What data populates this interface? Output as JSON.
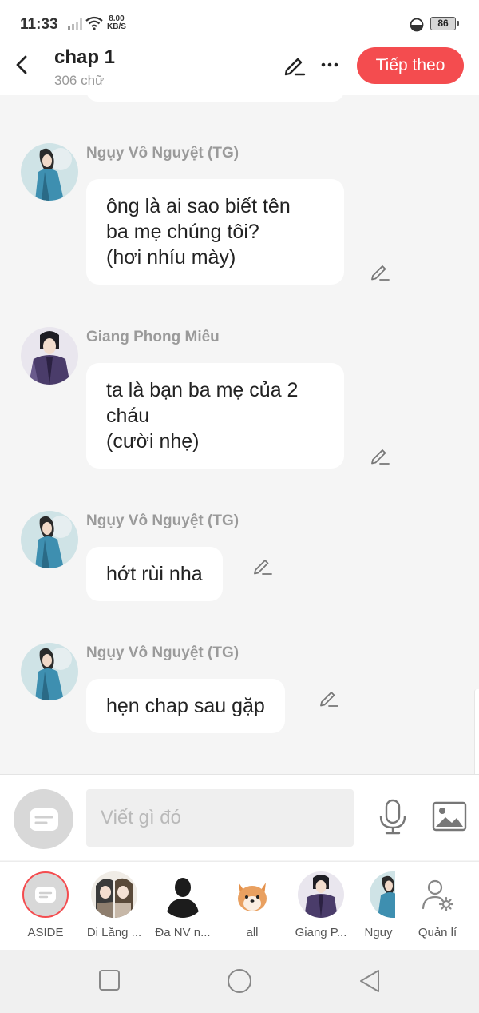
{
  "status": {
    "time": "11:33",
    "speed_top": "8.00",
    "speed_unit": "KB/S",
    "battery": "86"
  },
  "header": {
    "title": "chap 1",
    "subtitle": "306 chữ",
    "next_label": "Tiếp theo"
  },
  "messages": [
    {
      "sender": "Ngụy Vô Nguyệt (TG)",
      "text": "ông là ai sao biết tên\nba mẹ chúng tôi?\n(hơi nhíu mày)",
      "avatar": "green-robed-character-avatar"
    },
    {
      "sender": "Giang Phong Miêu",
      "text": "ta là bạn ba mẹ của 2\ncháu\n(cười nhẹ)",
      "avatar": "purple-robed-character-avatar"
    },
    {
      "sender": "Ngụy Vô Nguyệt (TG)",
      "text": "hớt rùi nha",
      "avatar": "green-robed-character-avatar"
    },
    {
      "sender": "Ngụy Vô Nguyệt (TG)",
      "text": "hẹn chap sau gặp",
      "avatar": "green-robed-character-avatar"
    }
  ],
  "composer": {
    "placeholder": "Viết gì đó"
  },
  "characters": [
    {
      "label": "ASIDE"
    },
    {
      "label": "Di Lăng ..."
    },
    {
      "label": "Đa NV n..."
    },
    {
      "label": "all"
    },
    {
      "label": "Giang P..."
    },
    {
      "label": "Nguy"
    },
    {
      "label": "Quản lí"
    }
  ],
  "colors": {
    "accent": "#f44c4f",
    "background": "#f5f5f5",
    "bubble": "#ffffff",
    "sender": "#9a9a9a"
  }
}
